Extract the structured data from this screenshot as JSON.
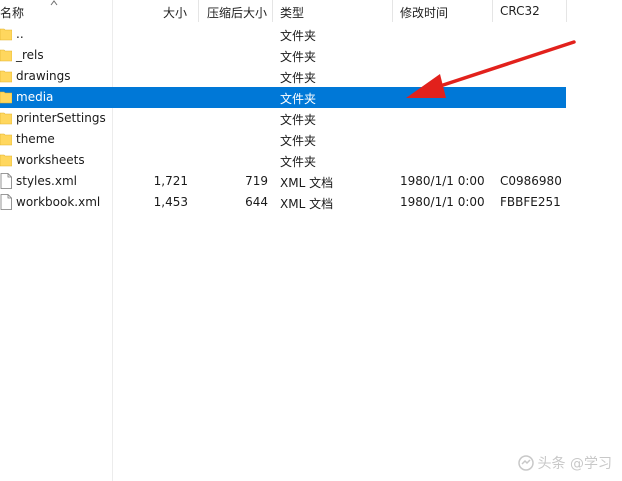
{
  "columns": {
    "name": "名称",
    "size": "大小",
    "compressed": "压缩后大小",
    "type": "类型",
    "modified": "修改时间",
    "crc": "CRC32"
  },
  "rows": [
    {
      "name": "..",
      "size": "",
      "compressed": "",
      "type": "文件夹",
      "modified": "",
      "crc": "",
      "icon": "folder-icon",
      "selected": false
    },
    {
      "name": "_rels",
      "size": "",
      "compressed": "",
      "type": "文件夹",
      "modified": "",
      "crc": "",
      "icon": "folder-icon",
      "selected": false
    },
    {
      "name": "drawings",
      "size": "",
      "compressed": "",
      "type": "文件夹",
      "modified": "",
      "crc": "",
      "icon": "folder-icon",
      "selected": false
    },
    {
      "name": "media",
      "size": "",
      "compressed": "",
      "type": "文件夹",
      "modified": "",
      "crc": "",
      "icon": "folder-icon",
      "selected": true
    },
    {
      "name": "printerSettings",
      "size": "",
      "compressed": "",
      "type": "文件夹",
      "modified": "",
      "crc": "",
      "icon": "folder-icon",
      "selected": false
    },
    {
      "name": "theme",
      "size": "",
      "compressed": "",
      "type": "文件夹",
      "modified": "",
      "crc": "",
      "icon": "folder-icon",
      "selected": false
    },
    {
      "name": "worksheets",
      "size": "",
      "compressed": "",
      "type": "文件夹",
      "modified": "",
      "crc": "",
      "icon": "folder-icon",
      "selected": false
    },
    {
      "name": "styles.xml",
      "size": "1,721",
      "compressed": "719",
      "type": "XML 文档",
      "modified": "1980/1/1 0:00",
      "crc": "C0986980",
      "icon": "file-icon",
      "selected": false
    },
    {
      "name": "workbook.xml",
      "size": "1,453",
      "compressed": "644",
      "type": "XML 文档",
      "modified": "1980/1/1 0:00",
      "crc": "FBBFE251",
      "icon": "file-icon",
      "selected": false
    }
  ],
  "colors": {
    "selection": "#0078d7",
    "folder": "#ffd75e",
    "arrow": "#e2211c"
  },
  "watermark": "头条 @学习"
}
